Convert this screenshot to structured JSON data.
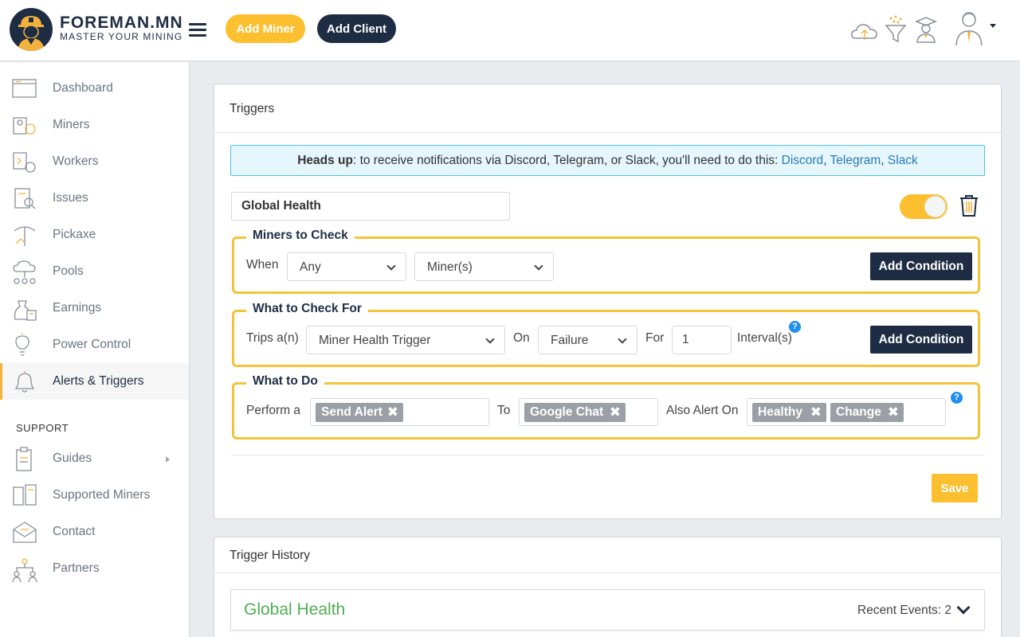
{
  "brand": {
    "title": "FOREMAN.MN",
    "subtitle": "MASTER YOUR MINING"
  },
  "header": {
    "add_miner": "Add Miner",
    "add_client": "Add Client",
    "icons": [
      "cloud-icon",
      "funnel-icon",
      "graduate-icon",
      "user-avatar-icon"
    ]
  },
  "sidebar": {
    "items": [
      {
        "label": "Dashboard",
        "icon": "dashboard-icon"
      },
      {
        "label": "Miners",
        "icon": "miners-icon"
      },
      {
        "label": "Workers",
        "icon": "workers-icon"
      },
      {
        "label": "Issues",
        "icon": "issues-icon"
      },
      {
        "label": "Pickaxe",
        "icon": "pickaxe-icon"
      },
      {
        "label": "Pools",
        "icon": "pools-icon"
      },
      {
        "label": "Earnings",
        "icon": "earnings-icon"
      },
      {
        "label": "Power Control",
        "icon": "lightbulb-icon"
      },
      {
        "label": "Alerts & Triggers",
        "icon": "bell-icon",
        "active": true
      }
    ],
    "support_label": "SUPPORT",
    "support_items": [
      {
        "label": "Guides",
        "icon": "guides-icon"
      },
      {
        "label": "Supported Miners",
        "icon": "supported-miners-icon"
      },
      {
        "label": "Contact",
        "icon": "contact-icon"
      },
      {
        "label": "Partners",
        "icon": "partners-icon"
      }
    ]
  },
  "triggers": {
    "title": "Triggers",
    "heads_up": {
      "bold": "Heads up",
      "text": ": to receive notifications via Discord, Telegram, or Slack, you'll need to do this: ",
      "links": [
        "Discord",
        "Telegram",
        "Slack"
      ],
      "sep": ", "
    },
    "name_value": "Global Health",
    "enabled": true,
    "miners_to_check": {
      "legend": "Miners to Check",
      "when_label": "When",
      "when_value": "Any",
      "miners_value": "Miner(s)",
      "add_condition": "Add Condition"
    },
    "what_to_check": {
      "legend": "What to Check For",
      "trips_label": "Trips a(n)",
      "trips_value": "Miner Health Trigger",
      "on_label": "On",
      "on_value": "Failure",
      "for_label": "For",
      "for_value": "1",
      "intervals_label": "Interval(s)",
      "add_condition": "Add Condition",
      "help": "?"
    },
    "what_to_do": {
      "legend": "What to Do",
      "perform_label": "Perform a",
      "perform_tags": [
        "Send Alert"
      ],
      "to_label": "To",
      "to_tags": [
        "Google Chat"
      ],
      "also_label": "Also Alert On",
      "also_tags": [
        "Healthy",
        "Change"
      ],
      "help": "?",
      "remove": "✖"
    },
    "save": "Save"
  },
  "history": {
    "title": "Trigger History",
    "name": "Global Health",
    "recent": "Recent Events: 2"
  }
}
